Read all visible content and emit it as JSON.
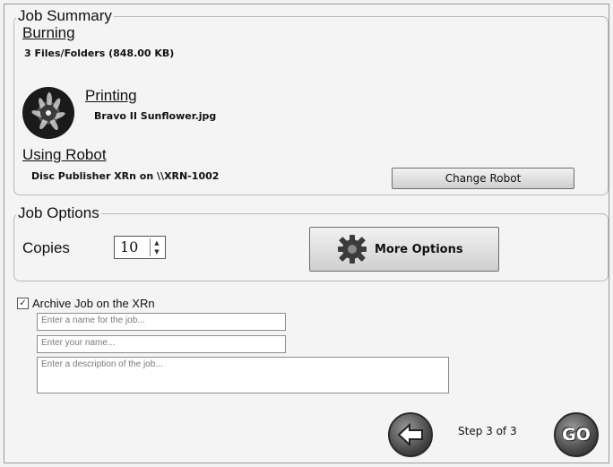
{
  "job_summary": {
    "legend": "Job Summary",
    "burning": {
      "title": "Burning",
      "detail": "3 Files/Folders (848.00 KB)"
    },
    "printing": {
      "title": "Printing",
      "detail": "Bravo II Sunflower.jpg"
    },
    "robot": {
      "title": "Using Robot",
      "detail": "Disc Publisher XRn on \\\\XRN-1002"
    },
    "change_robot_label": "Change Robot"
  },
  "job_options": {
    "legend": "Job Options",
    "copies_label": "Copies",
    "copies_value": "10",
    "more_options_label": "More Options"
  },
  "archive": {
    "checked": true,
    "label": "Archive Job on the XRn",
    "job_name_placeholder": "Enter a name for the job...",
    "user_name_placeholder": "Enter your name...",
    "description_placeholder": "Enter a description of the job..."
  },
  "footer": {
    "step_text": "Step 3 of 3",
    "go_label": "GO"
  },
  "icons": {
    "back": "back-arrow-icon",
    "gear": "gear-icon",
    "disc": "disc-thumbnail",
    "check": "checkbox-icon"
  }
}
